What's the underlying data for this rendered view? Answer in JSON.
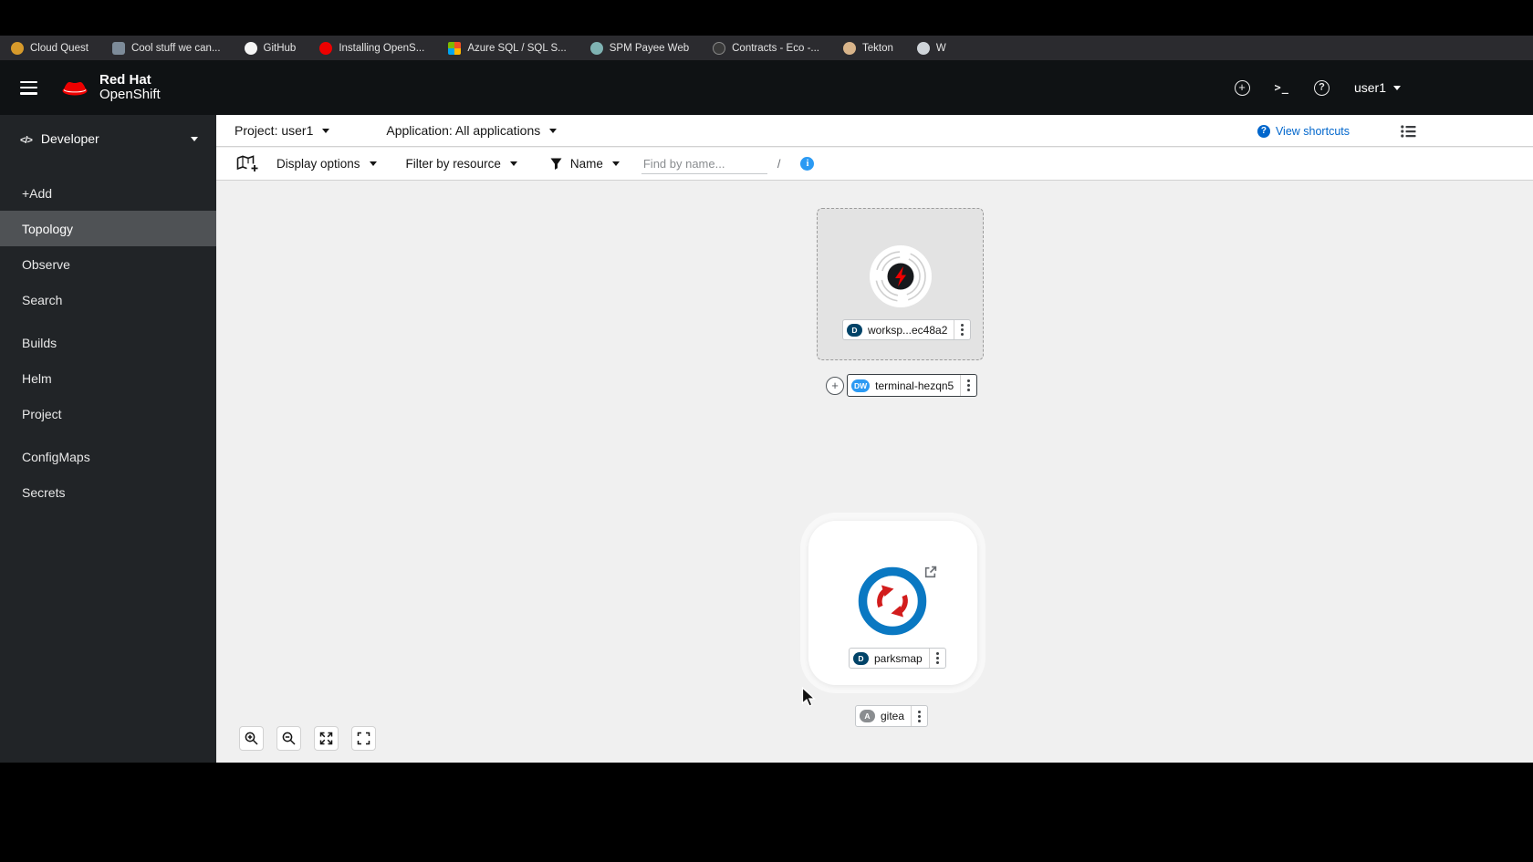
{
  "bookmarks": {
    "items": [
      {
        "label": "Cloud Quest"
      },
      {
        "label": "Cool stuff we can..."
      },
      {
        "label": "GitHub"
      },
      {
        "label": "Installing OpenS..."
      },
      {
        "label": "Azure SQL / SQL S..."
      },
      {
        "label": "SPM Payee Web"
      },
      {
        "label": "Contracts - Eco -..."
      },
      {
        "label": "Tekton"
      },
      {
        "label": "W"
      }
    ]
  },
  "masthead": {
    "brand_line1": "Red Hat",
    "brand_line2": "OpenShift",
    "username": "user1",
    "icons": [
      "add-circle-icon",
      "terminal-icon",
      "help-icon"
    ]
  },
  "sidebar": {
    "perspective": "Developer",
    "selected": "Topology",
    "items": [
      {
        "label": "+Add"
      },
      {
        "label": "Topology"
      },
      {
        "label": "Observe"
      },
      {
        "label": "Search"
      },
      {
        "label": "Builds"
      },
      {
        "label": "Helm"
      },
      {
        "label": "Project"
      },
      {
        "label": "ConfigMaps"
      },
      {
        "label": "Secrets"
      }
    ]
  },
  "context_bar": {
    "project": "Project: user1",
    "application": "Application: All applications",
    "view_shortcuts": "View shortcuts"
  },
  "toolbar": {
    "display_options": "Display options",
    "filter_by_resource": "Filter by resource",
    "name_filter": "Name",
    "find_placeholder": "Find by name...",
    "find_value": "",
    "shortcut_key": "/"
  },
  "topology": {
    "workspace": {
      "badge": "D",
      "label": "worksp...ec48a2"
    },
    "terminal": {
      "badge": "DW",
      "label": "terminal-hezqn5"
    },
    "parksmap": {
      "badge": "D",
      "label": "parksmap"
    },
    "gitea": {
      "badge": "A",
      "label": "gitea"
    }
  },
  "colors": {
    "accent_blue": "#0066cc",
    "info_blue": "#2b9af3",
    "badge_deployment": "#004368",
    "badge_devworkspace": "#2b9af3",
    "badge_application": "#8a8d90",
    "brand_red": "#ee0000",
    "canvas_gray": "#f0f0f0",
    "sidebar_dark": "#212427"
  }
}
